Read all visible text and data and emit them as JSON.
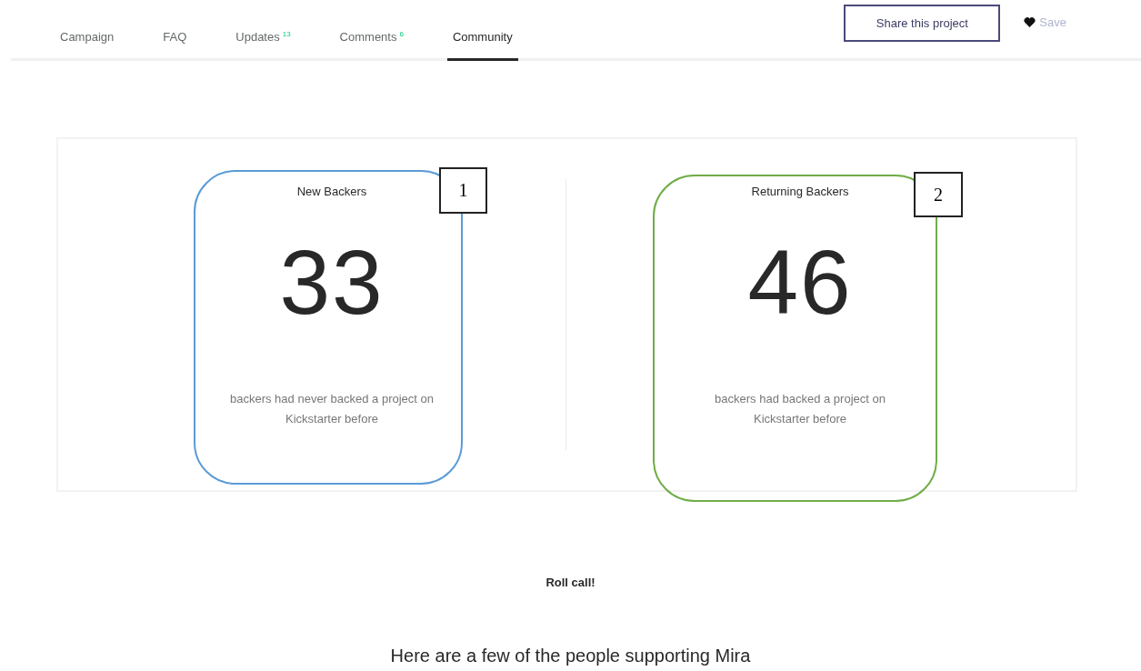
{
  "tabs": [
    {
      "label": "Campaign",
      "selected": false
    },
    {
      "label": "FAQ",
      "selected": false
    },
    {
      "label": "Updates",
      "count": "13",
      "selected": false
    },
    {
      "label": "Comments",
      "count": "6",
      "selected": false
    },
    {
      "label": "Community",
      "selected": true
    }
  ],
  "share_button": "Share this project",
  "save_button": "Save",
  "stats": [
    {
      "title": "New Backers",
      "number": "33",
      "description": "backers had never backed a project on Kickstarter before",
      "callout": "1",
      "color": "#5b9bd5"
    },
    {
      "title": "Returning Backers",
      "number": "46",
      "description": "backers had backed a project on Kickstarter before",
      "callout": "2",
      "color": "#70ad47"
    }
  ],
  "roll_call": "Roll call!",
  "supporters_heading": "Here are a few of the people supporting Mira"
}
